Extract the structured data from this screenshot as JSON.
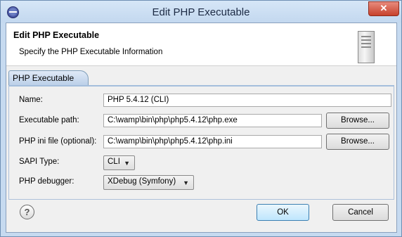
{
  "window": {
    "title": "Edit PHP Executable",
    "close_glyph": "✕"
  },
  "header": {
    "title": "Edit PHP Executable",
    "description": "Specify the PHP Executable Information"
  },
  "tabs": [
    {
      "label": "PHP Executable"
    }
  ],
  "form": {
    "name": {
      "label": "Name:",
      "value": "PHP 5.4.12 (CLI)"
    },
    "executable_path": {
      "label": "Executable path:",
      "value": "C:\\wamp\\bin\\php\\php5.4.12\\php.exe",
      "browse": "Browse..."
    },
    "php_ini": {
      "label": "PHP ini file (optional):",
      "value": "C:\\wamp\\bin\\php\\php5.4.12\\php.ini",
      "browse": "Browse..."
    },
    "sapi_type": {
      "label": "SAPI Type:",
      "selected": "CLI"
    },
    "php_debugger": {
      "label": "PHP debugger:",
      "selected": "XDebug (Symfony)"
    }
  },
  "footer": {
    "help_glyph": "?",
    "ok": "OK",
    "cancel": "Cancel"
  }
}
